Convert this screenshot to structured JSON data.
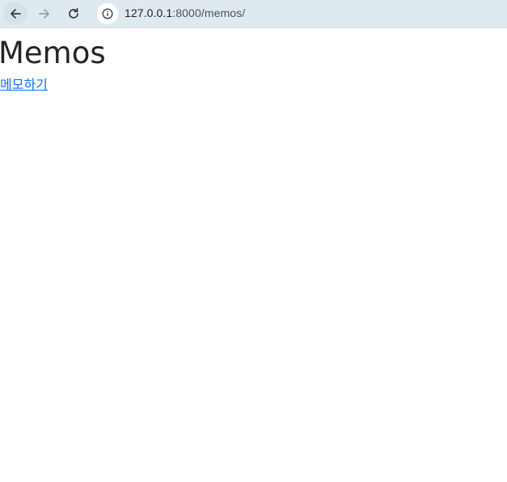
{
  "browser": {
    "url_host": "127.0.0.1",
    "url_rest": ":8000/memos/",
    "icons": {
      "back": "arrow-left-icon",
      "forward": "arrow-right-icon",
      "reload": "reload-icon",
      "site_info": "info-icon"
    }
  },
  "page": {
    "title": "Memos",
    "link_label": "메모하기"
  },
  "colors": {
    "link": "#0d6efd",
    "title": "#212529",
    "toolbar": "#dfeaf0"
  }
}
